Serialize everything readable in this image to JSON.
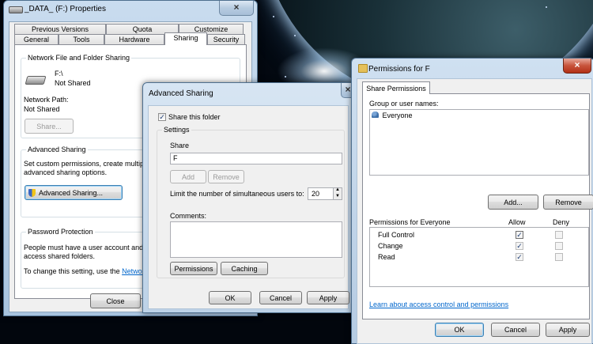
{
  "properties": {
    "title": "_DATA_ (F:) Properties",
    "tabs_row1": [
      "Previous Versions",
      "Quota",
      "Customize"
    ],
    "tabs_row2": [
      "General",
      "Tools",
      "Hardware",
      "Sharing",
      "Security"
    ],
    "network_sharing": {
      "heading": "Network File and Folder Sharing",
      "drive": "F:\\",
      "drive_status": "Not Shared",
      "path_label": "Network Path:",
      "path_value": "Not Shared",
      "share_button": "Share..."
    },
    "advanced": {
      "heading": "Advanced Sharing",
      "desc_line1": "Set custom permissions, create multipl",
      "desc_line2": "advanced sharing options.",
      "button": "Advanced Sharing..."
    },
    "password": {
      "heading": "Password Protection",
      "line1": "People must have a user account and",
      "line2": "access shared folders.",
      "line3": "To change this setting, use the",
      "link": "Networ"
    },
    "close_button": "Close"
  },
  "advanced_sharing": {
    "title": "Advanced Sharing",
    "share_checkbox": "Share this folder",
    "settings_label": "Settings",
    "share_label": "Share",
    "share_value": "F",
    "add_button": "Add",
    "remove_button": "Remove",
    "limit_label": "Limit the number of simultaneous users to:",
    "limit_value": "20",
    "comments_label": "Comments:",
    "permissions_button": "Permissions",
    "caching_button": "Caching",
    "ok": "OK",
    "cancel": "Cancel",
    "apply": "Apply"
  },
  "permissions": {
    "title": "Permissions for F",
    "tab": "Share Permissions",
    "group_label": "Group or user names:",
    "users": [
      "Everyone"
    ],
    "add_button": "Add...",
    "remove_button": "Remove",
    "perm_header": "Permissions for Everyone",
    "allow_header": "Allow",
    "deny_header": "Deny",
    "rows": [
      {
        "name": "Full Control",
        "allow": true,
        "deny": false
      },
      {
        "name": "Change",
        "allow": true,
        "deny": false
      },
      {
        "name": "Read",
        "allow": true,
        "deny": false
      }
    ],
    "learn_link": "Learn about access control and permissions",
    "ok": "OK",
    "cancel": "Cancel",
    "apply": "Apply"
  },
  "icons": {
    "close": "×",
    "checkmark": "✓",
    "spin_up": "▲",
    "spin_down": "▼"
  }
}
